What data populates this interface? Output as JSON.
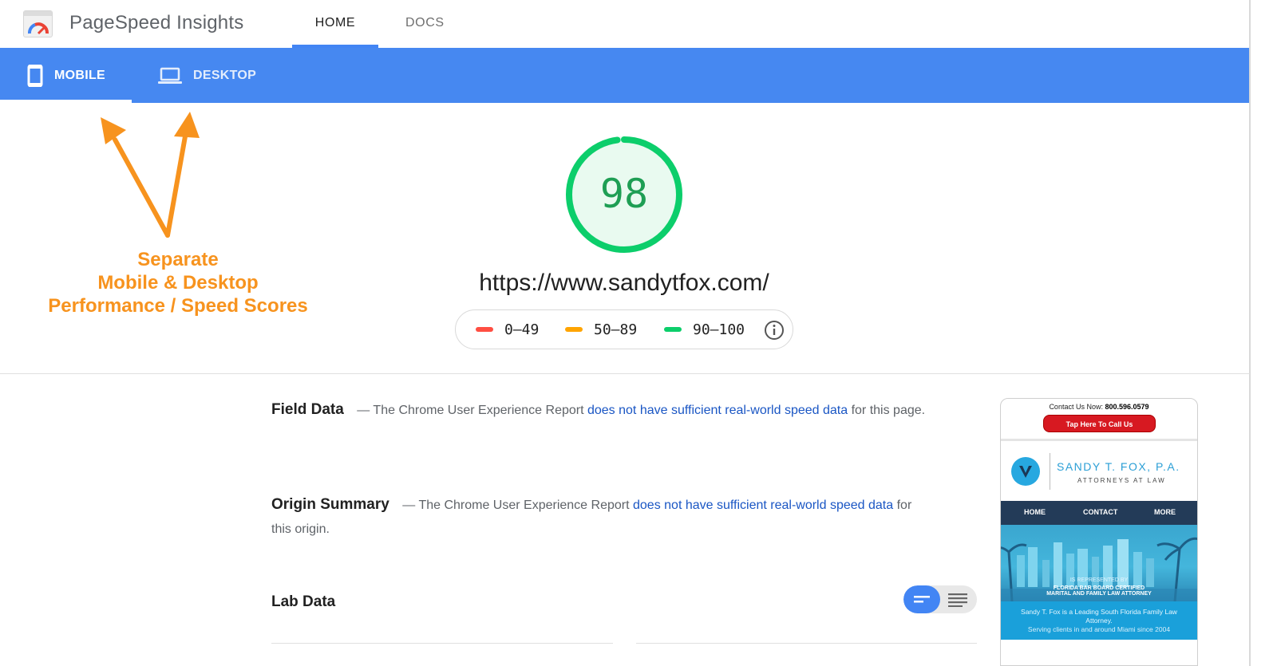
{
  "header": {
    "app_title": "PageSpeed Insights",
    "nav": [
      {
        "label": "HOME",
        "active": true
      },
      {
        "label": "DOCS",
        "active": false
      }
    ]
  },
  "devices": [
    {
      "label": "MOBILE",
      "icon": "smartphone-icon",
      "active": true
    },
    {
      "label": "DESKTOP",
      "icon": "laptop-icon",
      "active": false
    }
  ],
  "score": {
    "value": "98",
    "fraction": 0.98,
    "url": "https://www.sandytfox.com/",
    "color": "#0cce6b"
  },
  "legend": [
    {
      "range": "0–49",
      "color": "#ff4e42"
    },
    {
      "range": "50–89",
      "color": "#ffa400"
    },
    {
      "range": "90–100",
      "color": "#0cce6b"
    }
  ],
  "annotation": {
    "line1": "Separate",
    "line2": "Mobile & Desktop",
    "line3": "Performance / Speed Scores",
    "color": "#f7931e"
  },
  "field_data": {
    "heading": "Field Data",
    "prefix": "— The Chrome User Experience Report",
    "link": "does not have sufficient real-world speed data",
    "suffix": "for this page."
  },
  "origin_summary": {
    "heading": "Origin Summary",
    "prefix": "— The Chrome User Experience Report",
    "link": "does not have sufficient real-world speed data",
    "suffix": "for this origin."
  },
  "lab_data": {
    "heading": "Lab Data"
  },
  "phone_preview": {
    "contact_label": "Contact Us Now:",
    "phone": "800.596.0579",
    "call_button": "Tap Here To Call Us",
    "firm_name": "SANDY T. FOX, P.A.",
    "firm_sub": "ATTORNEYS AT LAW",
    "nav": [
      "HOME",
      "CONTACT",
      "MORE"
    ],
    "hero_line1": "IS REPRESENTED BY",
    "hero_line2": "FLORIDA BAR BOARD CERTIFIED",
    "hero_line3": "MARITAL AND FAMILY LAW ATTORNEY",
    "blurb1": "Sandy T. Fox is a Leading South Florida Family Law Attorney.",
    "blurb2": "Serving clients in and around Miami since 2004"
  }
}
